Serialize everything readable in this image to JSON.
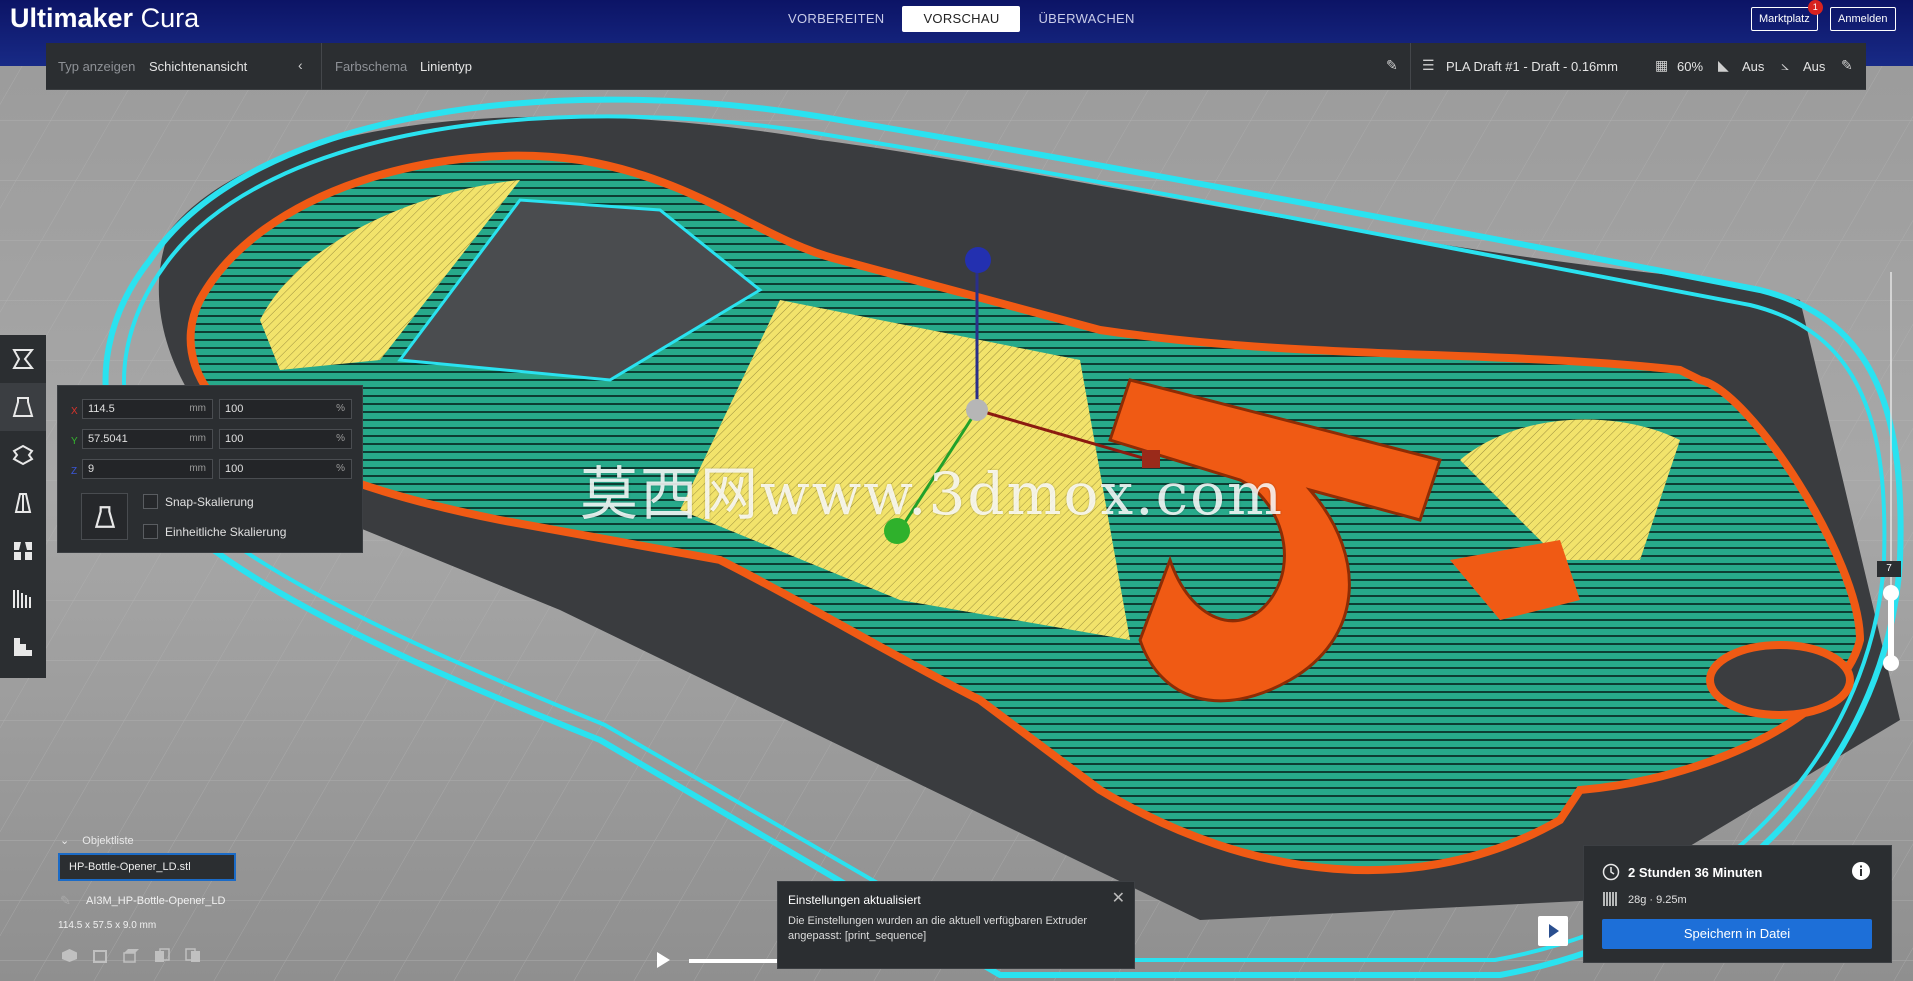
{
  "app": {
    "brand_bold": "Ultimaker",
    "brand_light": "Cura"
  },
  "stages": [
    {
      "label": "VORBEREITEN",
      "active": false
    },
    {
      "label": "VORSCHAU",
      "active": true
    },
    {
      "label": "ÜBERWACHEN",
      "active": false
    }
  ],
  "header_buttons": {
    "marketplace": "Marktplatz",
    "marketplace_badge": "1",
    "login": "Anmelden"
  },
  "viewbar": {
    "view_type_label": "Typ anzeigen",
    "view_type_value": "Schichtenansicht",
    "color_scheme_label": "Farbschema",
    "color_scheme_value": "Linientyp",
    "profile": "PLA Draft #1 - Draft - 0.16mm",
    "infill": "60%",
    "support": "Aus",
    "adhesion": "Aus"
  },
  "toolbar": {
    "tools": [
      "move-tool-icon",
      "scale-tool-icon",
      "rotate-tool-icon",
      "mirror-tool-icon",
      "per-model-settings-icon",
      "support-blocker-icon",
      "layer-view-icon"
    ],
    "active_tool": "scale-tool-icon"
  },
  "scale_panel": {
    "x_label": "X",
    "y_label": "Y",
    "z_label": "Z",
    "x_mm": "114.5",
    "y_mm": "57.5041",
    "z_mm": "9",
    "x_pct": "100",
    "y_pct": "100",
    "z_pct": "100",
    "unit_mm": "mm",
    "unit_pct": "%",
    "snap_scaling": "Snap-Skalierung",
    "uniform_scaling": "Einheitliche Skalierung"
  },
  "object_list": {
    "header": "Objektliste",
    "file": "HP-Bottle-Opener_LD.stl",
    "job_name": "AI3M_HP-Bottle-Opener_LD",
    "dimensions": "114.5 x 57.5 x 9.0 mm"
  },
  "layer_view": {
    "current_layer": "7",
    "max_layer": "7"
  },
  "notification": {
    "title": "Einstellungen aktualisiert",
    "body": "Die Einstellungen wurden an die aktuell verfügbaren Extruder angepasst: [print_sequence]"
  },
  "estimate": {
    "time": "2 Stunden 36 Minuten",
    "material": "28g · 9.25m",
    "save_button": "Speichern in Datei"
  },
  "watermark": "莫西网www.3dmox.com",
  "colors": {
    "header": "#14206f",
    "panel": "#2b2e31",
    "accent": "#1d6fd8",
    "wall_outer": "#f05a14",
    "wall_inner": "#27a98a",
    "infill": "#f5e96a",
    "skirt": "#2ae2f0"
  }
}
